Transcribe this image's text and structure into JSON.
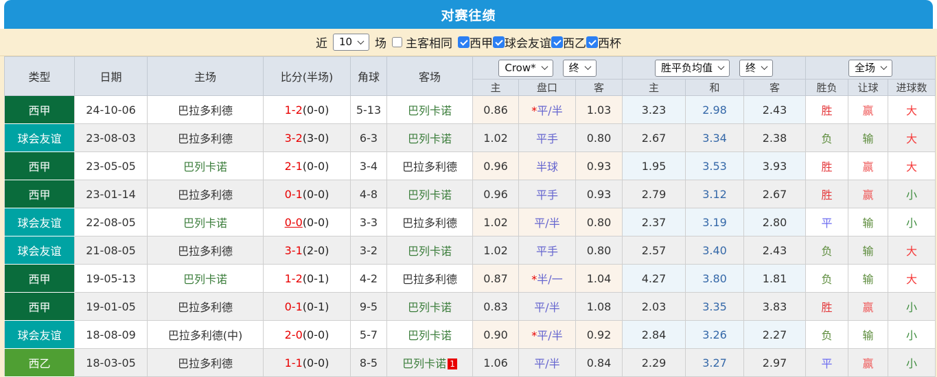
{
  "header": {
    "title": "对赛往绩"
  },
  "filter": {
    "near_label": "近",
    "count_value": "10",
    "games_label": "场",
    "same_venue_label": "主客相同",
    "same_venue_checked": false,
    "leagues": [
      {
        "label": "西甲",
        "checked": true
      },
      {
        "label": "球会友谊",
        "checked": true
      },
      {
        "label": "西乙",
        "checked": true
      },
      {
        "label": "西杯",
        "checked": true
      }
    ]
  },
  "table": {
    "main_headers": [
      "类型",
      "日期",
      "主场",
      "比分(半场)",
      "角球",
      "客场"
    ],
    "selects": {
      "odds_source": "Crow*",
      "odds_stage": "终",
      "avg_type": "胜平负均值",
      "avg_stage": "终",
      "scope": "全场"
    },
    "sub_headers": [
      "主",
      "盘口",
      "客",
      "主",
      "和",
      "客",
      "胜负",
      "让球",
      "进球数"
    ],
    "rows": [
      {
        "type": "西甲",
        "type_key": "laliga",
        "date": "24-10-06",
        "home": "巴拉多利德",
        "home_focus": false,
        "score": "1-2",
        "half": "(0-0)",
        "score_underline": false,
        "corner": "5-13",
        "away": "巴列卡诺",
        "away_focus": true,
        "away_badge": "",
        "crown_home": "0.86",
        "handicap_star": "*",
        "handicap": "平/半",
        "crown_away": "1.03",
        "avg_home": "3.23",
        "avg_draw": "2.98",
        "avg_away": "2.43",
        "result": "胜",
        "result_key": "win",
        "handicap_result": "赢",
        "handicap_result_key": "win",
        "goals": "大",
        "goals_key": "over"
      },
      {
        "type": "球会友谊",
        "type_key": "friendly",
        "date": "23-08-03",
        "home": "巴拉多利德",
        "home_focus": false,
        "score": "3-2",
        "half": "(3-0)",
        "score_underline": false,
        "corner": "6-3",
        "away": "巴列卡诺",
        "away_focus": true,
        "away_badge": "",
        "crown_home": "1.02",
        "handicap_star": "",
        "handicap": "平手",
        "crown_away": "0.80",
        "avg_home": "2.67",
        "avg_draw": "3.34",
        "avg_away": "2.38",
        "result": "负",
        "result_key": "lose",
        "handicap_result": "输",
        "handicap_result_key": "lose",
        "goals": "大",
        "goals_key": "over"
      },
      {
        "type": "西甲",
        "type_key": "laliga",
        "date": "23-05-05",
        "home": "巴列卡诺",
        "home_focus": true,
        "score": "2-1",
        "half": "(0-0)",
        "score_underline": false,
        "corner": "3-4",
        "away": "巴拉多利德",
        "away_focus": false,
        "away_badge": "",
        "crown_home": "0.96",
        "handicap_star": "",
        "handicap": "半球",
        "crown_away": "0.93",
        "avg_home": "1.95",
        "avg_draw": "3.53",
        "avg_away": "3.93",
        "result": "胜",
        "result_key": "win",
        "handicap_result": "赢",
        "handicap_result_key": "win",
        "goals": "大",
        "goals_key": "over"
      },
      {
        "type": "西甲",
        "type_key": "laliga",
        "date": "23-01-14",
        "home": "巴拉多利德",
        "home_focus": false,
        "score": "0-1",
        "half": "(0-0)",
        "score_underline": false,
        "corner": "4-8",
        "away": "巴列卡诺",
        "away_focus": true,
        "away_badge": "",
        "crown_home": "0.96",
        "handicap_star": "",
        "handicap": "平手",
        "crown_away": "0.93",
        "avg_home": "2.79",
        "avg_draw": "3.12",
        "avg_away": "2.67",
        "result": "胜",
        "result_key": "win",
        "handicap_result": "赢",
        "handicap_result_key": "win",
        "goals": "小",
        "goals_key": "under"
      },
      {
        "type": "球会友谊",
        "type_key": "friendly",
        "date": "22-08-05",
        "home": "巴列卡诺",
        "home_focus": true,
        "score": "0-0",
        "half": "(0-0)",
        "score_underline": true,
        "corner": "3-3",
        "away": "巴拉多利德",
        "away_focus": false,
        "away_badge": "",
        "crown_home": "1.02",
        "handicap_star": "",
        "handicap": "平/半",
        "crown_away": "0.80",
        "avg_home": "2.37",
        "avg_draw": "3.19",
        "avg_away": "2.80",
        "result": "平",
        "result_key": "draw",
        "handicap_result": "输",
        "handicap_result_key": "lose",
        "goals": "小",
        "goals_key": "under"
      },
      {
        "type": "球会友谊",
        "type_key": "friendly",
        "date": "21-08-05",
        "home": "巴拉多利德",
        "home_focus": false,
        "score": "3-1",
        "half": "(2-0)",
        "score_underline": false,
        "corner": "3-2",
        "away": "巴列卡诺",
        "away_focus": true,
        "away_badge": "",
        "crown_home": "1.02",
        "handicap_star": "",
        "handicap": "平手",
        "crown_away": "0.80",
        "avg_home": "2.57",
        "avg_draw": "3.40",
        "avg_away": "2.43",
        "result": "负",
        "result_key": "lose",
        "handicap_result": "输",
        "handicap_result_key": "lose",
        "goals": "大",
        "goals_key": "over"
      },
      {
        "type": "西甲",
        "type_key": "laliga",
        "date": "19-05-13",
        "home": "巴列卡诺",
        "home_focus": true,
        "score": "1-2",
        "half": "(0-1)",
        "score_underline": false,
        "corner": "4-2",
        "away": "巴拉多利德",
        "away_focus": false,
        "away_badge": "",
        "crown_home": "0.87",
        "handicap_star": "*",
        "handicap": "半/一",
        "crown_away": "1.04",
        "avg_home": "4.27",
        "avg_draw": "3.80",
        "avg_away": "1.81",
        "result": "负",
        "result_key": "lose",
        "handicap_result": "输",
        "handicap_result_key": "lose",
        "goals": "大",
        "goals_key": "over"
      },
      {
        "type": "西甲",
        "type_key": "laliga",
        "date": "19-01-05",
        "home": "巴拉多利德",
        "home_focus": false,
        "score": "0-1",
        "half": "(0-1)",
        "score_underline": false,
        "corner": "9-5",
        "away": "巴列卡诺",
        "away_focus": true,
        "away_badge": "",
        "crown_home": "0.83",
        "handicap_star": "",
        "handicap": "平/半",
        "crown_away": "1.08",
        "avg_home": "2.03",
        "avg_draw": "3.35",
        "avg_away": "3.83",
        "result": "胜",
        "result_key": "win",
        "handicap_result": "赢",
        "handicap_result_key": "win",
        "goals": "小",
        "goals_key": "under"
      },
      {
        "type": "球会友谊",
        "type_key": "friendly",
        "date": "18-08-09",
        "home": "巴拉多利德(中)",
        "home_focus": false,
        "score": "2-0",
        "half": "(0-0)",
        "score_underline": false,
        "corner": "5-7",
        "away": "巴列卡诺",
        "away_focus": true,
        "away_badge": "",
        "crown_home": "0.90",
        "handicap_star": "*",
        "handicap": "平/半",
        "crown_away": "0.92",
        "avg_home": "2.84",
        "avg_draw": "3.26",
        "avg_away": "2.27",
        "result": "负",
        "result_key": "lose",
        "handicap_result": "输",
        "handicap_result_key": "lose",
        "goals": "小",
        "goals_key": "under"
      },
      {
        "type": "西乙",
        "type_key": "laliga2",
        "date": "18-03-05",
        "home": "巴拉多利德",
        "home_focus": false,
        "score": "1-1",
        "half": "(0-0)",
        "score_underline": false,
        "corner": "8-5",
        "away": "巴列卡诺",
        "away_focus": true,
        "away_badge": "1",
        "crown_home": "1.06",
        "handicap_star": "",
        "handicap": "平/半",
        "crown_away": "0.84",
        "avg_home": "2.29",
        "avg_draw": "3.27",
        "avg_away": "2.97",
        "result": "平",
        "result_key": "draw",
        "handicap_result": "赢",
        "handicap_result_key": "win",
        "goals": "小",
        "goals_key": "under"
      }
    ]
  },
  "colors": {
    "title_bar": "#1D95D9",
    "filter_bar": "#FAEED1",
    "header_bg": "#DEE4EC",
    "laliga_type": "#0A6C3C",
    "friendly_type": "#00A3A3",
    "laliga2_type": "#4F9F33",
    "focus_team_green": "#3B7D3B",
    "score_red": "#E80000",
    "handicap_blue": "#6565CF",
    "avg_draw_blue": "#3568A8",
    "win_red": "#E4393C",
    "lose_green": "#5E8D3E",
    "draw_blue": "#6B6BF0",
    "crown_col_bg": "#FBF3EA",
    "avg_col_bg": "#EDF5FA",
    "checkbox_blue": "#2B7FF3"
  }
}
